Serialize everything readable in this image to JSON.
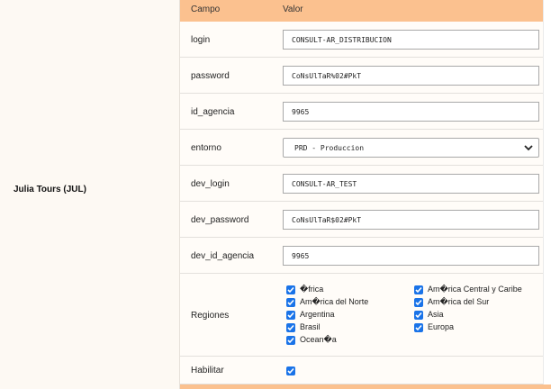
{
  "agency": {
    "name": "Julia Tours (JUL)"
  },
  "header": {
    "campo": "Campo",
    "valor": "Valor"
  },
  "fields": {
    "login": {
      "label": "login",
      "value": "CONSULT-AR_DISTRIBUCION"
    },
    "password": {
      "label": "password",
      "value": "CoNsUlTaR%02#PkT"
    },
    "id_agencia": {
      "label": "id_agencia",
      "value": "9965"
    },
    "entorno": {
      "label": "entorno",
      "value": "PRD - Produccion"
    },
    "dev_login": {
      "label": "dev_login",
      "value": "CONSULT-AR_TEST"
    },
    "dev_password": {
      "label": "dev_password",
      "value": "CoNsUlTaR$02#PkT"
    },
    "dev_id_agencia": {
      "label": "dev_id_agencia",
      "value": "9965"
    }
  },
  "regiones": {
    "label": "Regiones",
    "items": [
      {
        "label": "�frica",
        "checked": true
      },
      {
        "label": "Am�rica Central y Caribe",
        "checked": true
      },
      {
        "label": "Am�rica del Norte",
        "checked": true
      },
      {
        "label": "Am�rica del Sur",
        "checked": true
      },
      {
        "label": "Argentina",
        "checked": true
      },
      {
        "label": "Asia",
        "checked": true
      },
      {
        "label": "Brasil",
        "checked": true
      },
      {
        "label": "Europa",
        "checked": true
      },
      {
        "label": "Ocean�a",
        "checked": true
      }
    ]
  },
  "habilitar": {
    "label": "Habilitar",
    "checked": true
  },
  "colors": {
    "header": "#fbc18f",
    "checkbox": "#1a73e8",
    "row_bg": "#fffcf8"
  }
}
